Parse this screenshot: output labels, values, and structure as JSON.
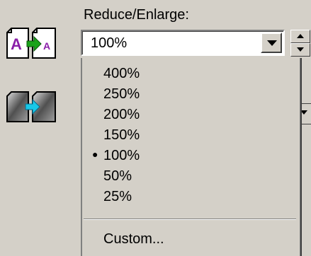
{
  "field": {
    "label": "Reduce/Enlarge:",
    "value": "100%"
  },
  "menu": {
    "items": [
      "400%",
      "250%",
      "200%",
      "150%",
      "100%",
      "50%",
      "25%"
    ],
    "selected_index": 4,
    "custom_label": "Custom..."
  },
  "icons": {
    "scale_icon": "scale-page-icon",
    "shade_icon": "shading-icon"
  },
  "colors": {
    "background": "#d4d0c8",
    "icon_accent_purple": "#8a1fa8",
    "icon_accent_green": "#1aa31a",
    "icon_accent_cyan": "#18c8e8"
  }
}
